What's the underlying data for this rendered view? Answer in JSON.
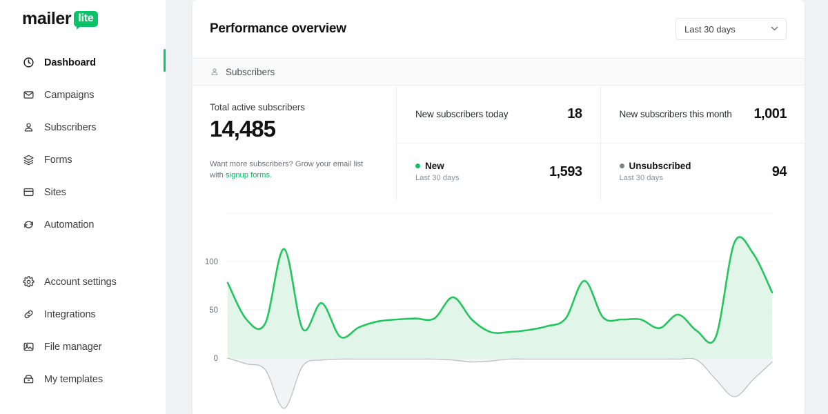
{
  "brand": {
    "name": "mailer",
    "badge": "lite",
    "badge_color": "#09C269"
  },
  "sidebar": {
    "groups": [
      {
        "items": [
          {
            "label": "Dashboard",
            "icon": "clock-icon",
            "active": true
          },
          {
            "label": "Campaigns",
            "icon": "envelope-icon",
            "active": false
          },
          {
            "label": "Subscribers",
            "icon": "person-icon",
            "active": false
          },
          {
            "label": "Forms",
            "icon": "layers-icon",
            "active": false
          },
          {
            "label": "Sites",
            "icon": "browser-icon",
            "active": false
          },
          {
            "label": "Automation",
            "icon": "refresh-icon",
            "active": false
          }
        ]
      },
      {
        "items": [
          {
            "label": "Account settings",
            "icon": "gear-icon",
            "active": false
          },
          {
            "label": "Integrations",
            "icon": "link-icon",
            "active": false
          },
          {
            "label": "File manager",
            "icon": "image-icon",
            "active": false
          },
          {
            "label": "My templates",
            "icon": "archive-icon",
            "active": false
          }
        ]
      }
    ]
  },
  "header": {
    "title": "Performance overview",
    "date_filter": {
      "value": "Last 30 days",
      "chevron": "chevron-down-icon"
    }
  },
  "tabs": [
    {
      "label": "Subscribers",
      "icon": "person-icon",
      "active": true
    }
  ],
  "stats": {
    "total": {
      "label": "Total active subscribers",
      "value": "14,485",
      "promo_text": "Want more subscribers? Grow your email list with ",
      "promo_link": "signup forms",
      "promo_end": "."
    },
    "cells": [
      {
        "label": "New subscribers today",
        "value": "18"
      },
      {
        "label": "New subscribers this month",
        "value": "1,001"
      }
    ],
    "series_cells": [
      {
        "label": "New",
        "sub": "Last 30 days",
        "value": "1,593",
        "dot_color": "#09C269"
      },
      {
        "label": "Unsubscribed",
        "sub": "Last 30 days",
        "value": "94",
        "dot_color": "#7C838B"
      }
    ]
  },
  "chart_data": {
    "type": "area",
    "title": "",
    "xlabel": "",
    "ylabel": "",
    "ylim": [
      -60,
      150
    ],
    "yticks": [
      0,
      50,
      100
    ],
    "ytick_labels": [
      "0",
      "50",
      "100"
    ],
    "gridlines": [
      0,
      50,
      100,
      150
    ],
    "grid": true,
    "legend_position": "none",
    "x": [
      1,
      2,
      3,
      4,
      5,
      6,
      7,
      8,
      9,
      10,
      11,
      12,
      13,
      14,
      15,
      16,
      17,
      18,
      19,
      20,
      21,
      22,
      23,
      24,
      25,
      26,
      27,
      28,
      29,
      30
    ],
    "series": [
      {
        "name": "New",
        "color": "#22C55E",
        "fill": "#E2F5E9",
        "values": [
          78,
          40,
          36,
          113,
          30,
          57,
          22,
          32,
          38,
          40,
          41,
          41,
          63,
          40,
          27,
          27,
          29,
          33,
          41,
          80,
          42,
          40,
          40,
          31,
          45,
          28,
          22,
          120,
          108,
          68
        ]
      },
      {
        "name": "Unsubscribed",
        "color": "#B9BEC4",
        "fill": "#F2F3F4",
        "values": [
          0,
          -6,
          -12,
          -52,
          -8,
          -2,
          -1,
          -1,
          -1,
          -1,
          -1,
          -1,
          -2,
          -4,
          -3,
          -1,
          -1,
          -1,
          -1,
          -1,
          -1,
          -1,
          -1,
          -1,
          -1,
          -2,
          -22,
          -40,
          -22,
          -4
        ]
      }
    ]
  }
}
